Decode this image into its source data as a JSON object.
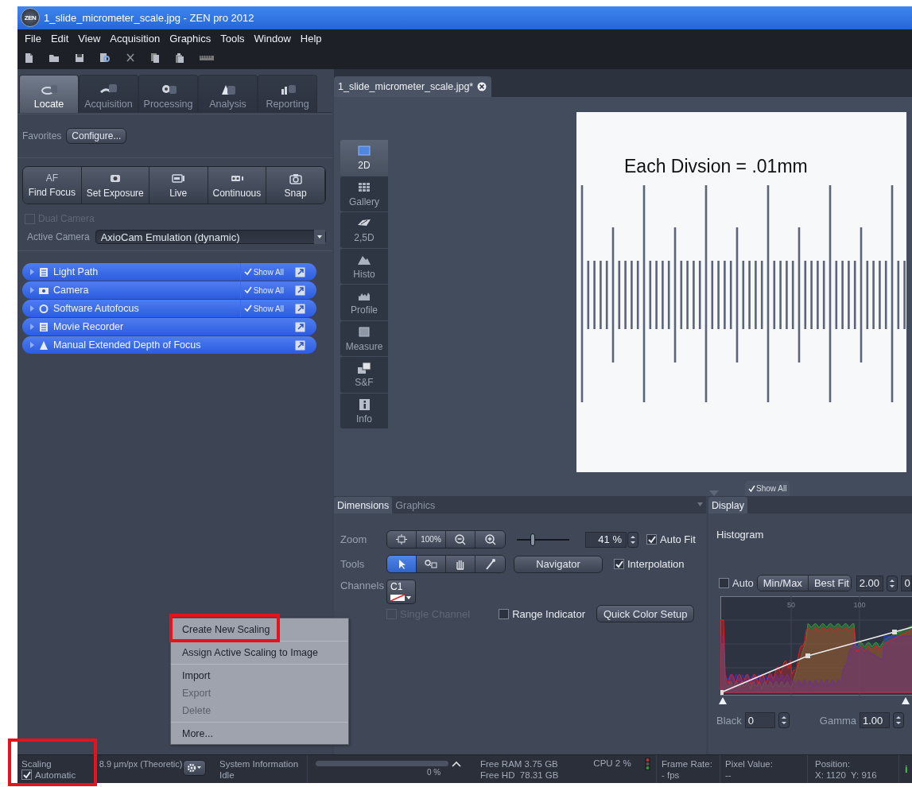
{
  "window": {
    "logo": "ZEN",
    "title": "1_slide_micrometer_scale.jpg - ZEN pro 2012"
  },
  "menu": [
    "File",
    "Edit",
    "View",
    "Acquisition",
    "Graphics",
    "Tools",
    "Window",
    "Help"
  ],
  "left_panel": {
    "tabs": [
      {
        "label": "Locate",
        "kind": "locate",
        "selected": true
      },
      {
        "label": "Acquisition",
        "kind": "acquisition",
        "selected": false
      },
      {
        "label": "Processing",
        "kind": "processing",
        "selected": false
      },
      {
        "label": "Analysis",
        "kind": "analysis",
        "selected": false
      },
      {
        "label": "Reporting",
        "kind": "reporting",
        "selected": false
      }
    ],
    "favorites": {
      "label": "Favorites",
      "button": "Configure..."
    },
    "actions": [
      {
        "kind": "text",
        "icon_text": "AF",
        "label": "Find Focus"
      },
      {
        "kind": "exposure",
        "label": "Set Exposure"
      },
      {
        "kind": "live",
        "label": "Live"
      },
      {
        "kind": "continuous",
        "label": "Continuous"
      },
      {
        "kind": "snap",
        "label": "Snap"
      }
    ],
    "dual_camera": {
      "label": "Dual Camera",
      "checked": false,
      "disabled": true
    },
    "active_camera": {
      "label": "Active Camera",
      "value": "AxioCam Emulation (dynamic)"
    },
    "tool_windows": [
      {
        "kind": "page",
        "label": "Light Path",
        "show_all": "Show All"
      },
      {
        "kind": "camera",
        "label": "Camera",
        "show_all": "Show All"
      },
      {
        "kind": "circle",
        "label": "Software Autofocus",
        "show_all": "Show All"
      },
      {
        "kind": "page",
        "label": "Movie Recorder"
      },
      {
        "kind": "triangle",
        "label": "Manual Extended Depth of Focus"
      }
    ]
  },
  "viewer": {
    "document_tab": {
      "label": "1_slide_micrometer_scale.jpg*",
      "selected": true
    },
    "view_tabs": [
      {
        "kind": "plane",
        "label": "2D",
        "selected": true
      },
      {
        "kind": "gallery",
        "label": "Gallery",
        "selected": false
      },
      {
        "kind": "surface",
        "label": "2,5D",
        "selected": false
      },
      {
        "kind": "histo",
        "label": "Histo",
        "selected": false
      },
      {
        "kind": "profile",
        "label": "Profile",
        "selected": false
      },
      {
        "kind": "measure",
        "label": "Measure",
        "selected": false
      },
      {
        "kind": "sf",
        "label": "S&F",
        "selected": false
      },
      {
        "kind": "info",
        "label": "Info",
        "selected": false
      }
    ],
    "image": {
      "caption": "Each Divsion = .01mm"
    },
    "show_all_tab": "Show All"
  },
  "dimensions_panel": {
    "tabs": [
      {
        "label": "Dimensions",
        "selected": true
      },
      {
        "label": "Graphics",
        "selected": false
      }
    ],
    "zoom": {
      "label": "Zoom",
      "buttons": [
        {
          "kind": "fit"
        },
        {
          "kind": "text",
          "label": "100%"
        },
        {
          "kind": "zoom-out"
        },
        {
          "kind": "zoom-in"
        }
      ],
      "slider": {
        "level": 0.3
      },
      "value": "41 %",
      "auto_fit": {
        "label": "Auto Fit",
        "checked": true
      }
    },
    "tools": {
      "label": "Tools",
      "buttons": [
        {
          "kind": "pointer",
          "selected": true
        },
        {
          "kind": "zoom-rect",
          "selected": false
        },
        {
          "kind": "hand",
          "selected": false
        },
        {
          "kind": "pipette",
          "selected": false
        }
      ],
      "navigator": "Navigator",
      "interpolation": {
        "label": "Interpolation",
        "checked": true
      }
    },
    "channels": {
      "label": "Channels",
      "channel": "C1"
    },
    "single_channel": {
      "label": "Single Channel",
      "checked": false,
      "disabled": true
    },
    "range_indicator": {
      "label": "Range Indicator",
      "checked": false
    },
    "quick_color_setup": "Quick Color Setup"
  },
  "display_panel": {
    "tab": {
      "label": "Display",
      "selected": true
    },
    "title": "Histogram",
    "auto": {
      "label": "Auto",
      "checked": false
    },
    "buttons": [
      "Min/Max",
      "Best Fit"
    ],
    "value_1": "2.00",
    "value_2": "0",
    "chart_ticks": [
      "50",
      "100"
    ],
    "black": {
      "label": "Black",
      "value": "0"
    },
    "gamma": {
      "label": "Gamma",
      "value": "1.00"
    }
  },
  "context_menu": [
    {
      "kind": "item",
      "label": "Create New Scaling",
      "disabled": false,
      "highlighted": true
    },
    {
      "kind": "separator"
    },
    {
      "kind": "item",
      "label": "Assign Active Scaling to Image",
      "disabled": false,
      "highlighted": false
    },
    {
      "kind": "separator"
    },
    {
      "kind": "item",
      "label": "Import",
      "disabled": false,
      "highlighted": false
    },
    {
      "kind": "item",
      "label": "Export",
      "disabled": true,
      "highlighted": false
    },
    {
      "kind": "item",
      "label": "Delete",
      "disabled": true,
      "highlighted": false
    },
    {
      "kind": "separator"
    },
    {
      "kind": "item",
      "label": "More...",
      "disabled": false,
      "highlighted": false
    }
  ],
  "status_bar": {
    "scaling": {
      "highlighted": true,
      "label": "Scaling",
      "value": "8.9 µm/px (Theoretic)",
      "automatic": {
        "label": "Automatic",
        "checked": true
      }
    },
    "system": {
      "title": "System Information",
      "state": "Idle"
    },
    "progress": {
      "level": 0,
      "reading": "0 %"
    },
    "resources": [
      "Free RAM 3.75 GB",
      "Free HD  78.31 GB"
    ],
    "cpu": "CPU 2 %",
    "frame_rate": {
      "label": "Frame Rate:",
      "value": "- fps"
    },
    "pixel_value": {
      "label": "Pixel Value:",
      "value": "--"
    },
    "position": {
      "label": "Position:",
      "value": "X: 1120  Y: 916"
    },
    "info": "i"
  }
}
